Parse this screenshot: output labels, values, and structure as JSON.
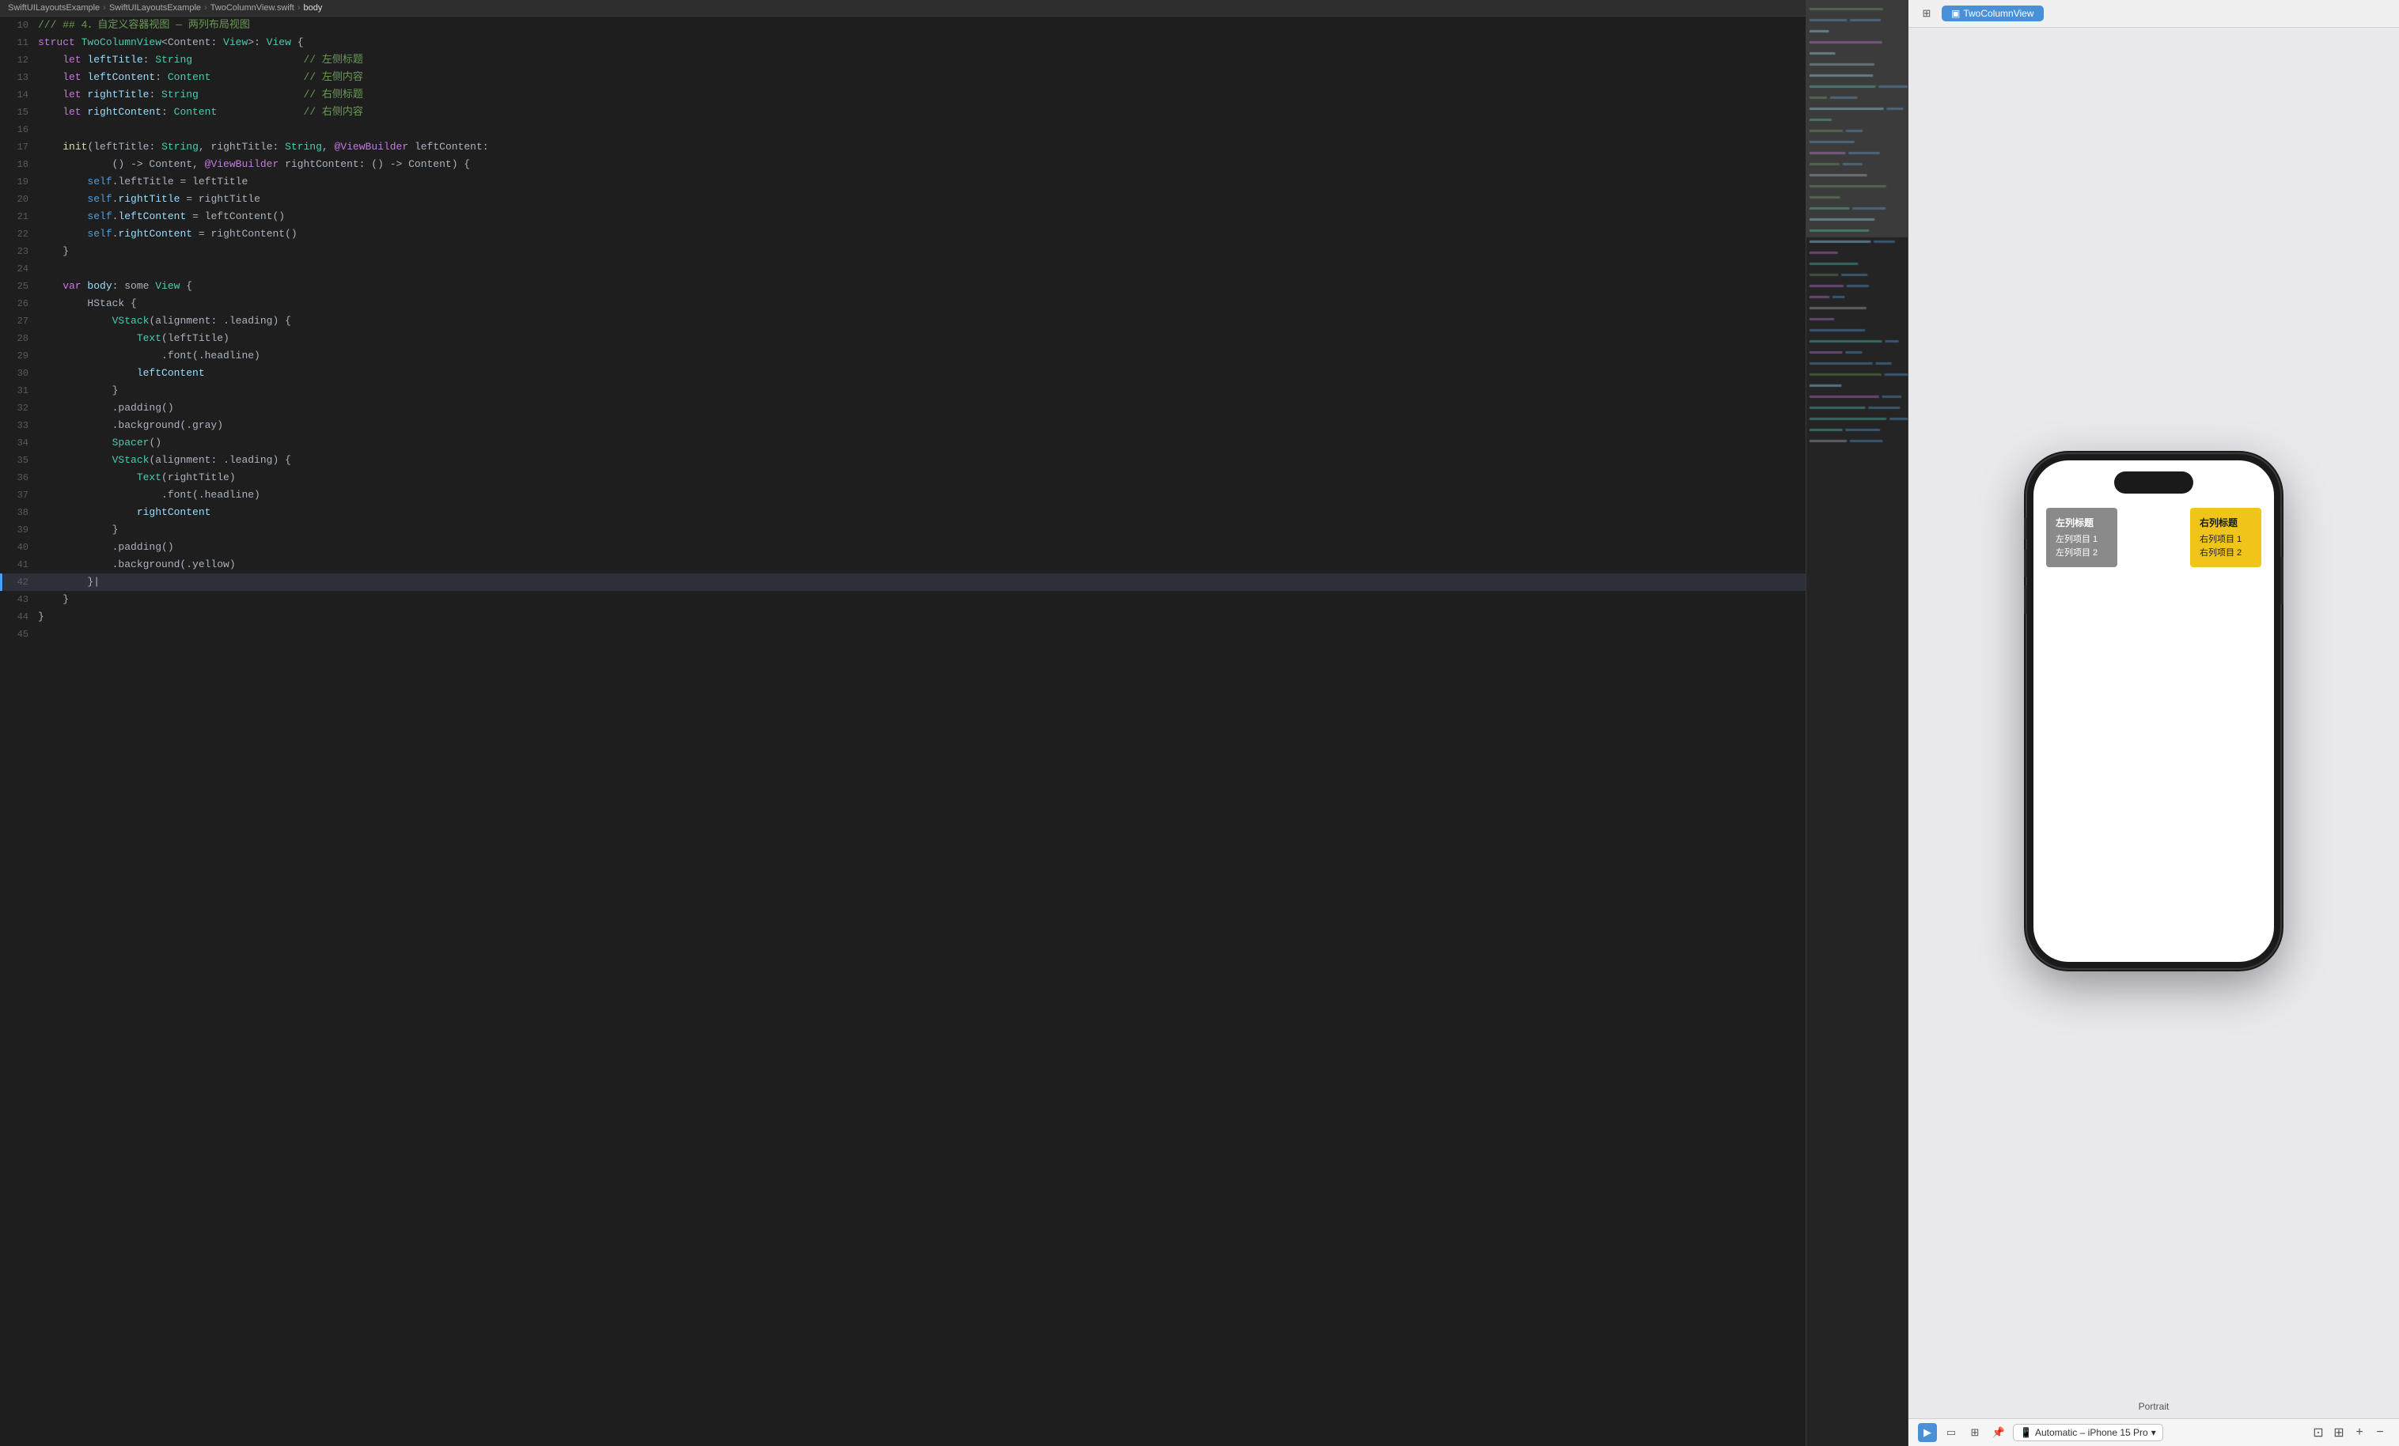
{
  "breadcrumb": {
    "items": [
      {
        "label": "SwiftUILayoutsExample",
        "active": false
      },
      {
        "label": "SwiftUILayoutsExample",
        "active": false
      },
      {
        "label": "TwoColumnView.swift",
        "active": false
      },
      {
        "label": "body",
        "active": true
      }
    ]
  },
  "editor": {
    "lines": [
      {
        "num": 10,
        "tokens": [
          {
            "text": "/// ## 4．自定义容器视图 — 两列布局视图",
            "cls": "kw-comment"
          }
        ]
      },
      {
        "num": 11,
        "tokens": [
          {
            "text": "struct ",
            "cls": "kw-pink"
          },
          {
            "text": "TwoColumnView",
            "cls": "kw-type"
          },
          {
            "text": "<Content: ",
            "cls": "kw-white"
          },
          {
            "text": "View",
            "cls": "kw-type"
          },
          {
            "text": ">: ",
            "cls": "kw-white"
          },
          {
            "text": "View",
            "cls": "kw-type"
          },
          {
            "text": " {",
            "cls": "kw-white"
          }
        ]
      },
      {
        "num": 12,
        "tokens": [
          {
            "text": "    let ",
            "cls": "kw-pink"
          },
          {
            "text": "leftTitle",
            "cls": "kw-var"
          },
          {
            "text": ": ",
            "cls": "kw-white"
          },
          {
            "text": "String",
            "cls": "kw-type"
          },
          {
            "text": "                  // 左侧标题",
            "cls": "kw-comment"
          }
        ]
      },
      {
        "num": 13,
        "tokens": [
          {
            "text": "    let ",
            "cls": "kw-pink"
          },
          {
            "text": "leftContent",
            "cls": "kw-var"
          },
          {
            "text": ": ",
            "cls": "kw-white"
          },
          {
            "text": "Content",
            "cls": "kw-type"
          },
          {
            "text": "               // 左侧内容",
            "cls": "kw-comment"
          }
        ]
      },
      {
        "num": 14,
        "tokens": [
          {
            "text": "    let ",
            "cls": "kw-pink"
          },
          {
            "text": "rightTitle",
            "cls": "kw-var"
          },
          {
            "text": ": ",
            "cls": "kw-white"
          },
          {
            "text": "String",
            "cls": "kw-type"
          },
          {
            "text": "                 // 右侧标题",
            "cls": "kw-comment"
          }
        ]
      },
      {
        "num": 15,
        "tokens": [
          {
            "text": "    let ",
            "cls": "kw-pink"
          },
          {
            "text": "rightContent",
            "cls": "kw-var"
          },
          {
            "text": ": ",
            "cls": "kw-white"
          },
          {
            "text": "Content",
            "cls": "kw-type"
          },
          {
            "text": "              // 右侧内容",
            "cls": "kw-comment"
          }
        ]
      },
      {
        "num": 16,
        "tokens": []
      },
      {
        "num": 17,
        "tokens": [
          {
            "text": "    ",
            "cls": ""
          },
          {
            "text": "init",
            "cls": "kw-func"
          },
          {
            "text": "(leftTitle: ",
            "cls": "kw-white"
          },
          {
            "text": "String",
            "cls": "kw-type"
          },
          {
            "text": ", rightTitle: ",
            "cls": "kw-white"
          },
          {
            "text": "String",
            "cls": "kw-type"
          },
          {
            "text": ", ",
            "cls": "kw-white"
          },
          {
            "text": "@ViewBuilder",
            "cls": "kw-pink"
          },
          {
            "text": " leftContent:",
            "cls": "kw-white"
          }
        ]
      },
      {
        "num": 18,
        "tokens": [
          {
            "text": "            () -> Content, ",
            "cls": "kw-white"
          },
          {
            "text": "@ViewBuilder",
            "cls": "kw-pink"
          },
          {
            "text": " rightContent: () -> Content) {",
            "cls": "kw-white"
          }
        ]
      },
      {
        "num": 19,
        "tokens": [
          {
            "text": "        ",
            "cls": ""
          },
          {
            "text": "self",
            "cls": "kw-keyword"
          },
          {
            "text": ".leftTitle = leftTitle",
            "cls": "kw-white"
          }
        ]
      },
      {
        "num": 20,
        "tokens": [
          {
            "text": "        ",
            "cls": ""
          },
          {
            "text": "self",
            "cls": "kw-keyword"
          },
          {
            "text": ".",
            "cls": "kw-white"
          },
          {
            "text": "rightTitle",
            "cls": "kw-var"
          },
          {
            "text": " = rightTitle",
            "cls": "kw-white"
          }
        ]
      },
      {
        "num": 21,
        "tokens": [
          {
            "text": "        ",
            "cls": ""
          },
          {
            "text": "self",
            "cls": "kw-keyword"
          },
          {
            "text": ".",
            "cls": "kw-white"
          },
          {
            "text": "leftContent",
            "cls": "kw-var"
          },
          {
            "text": " = leftContent()",
            "cls": "kw-white"
          }
        ]
      },
      {
        "num": 22,
        "tokens": [
          {
            "text": "        ",
            "cls": ""
          },
          {
            "text": "self",
            "cls": "kw-keyword"
          },
          {
            "text": ".",
            "cls": "kw-white"
          },
          {
            "text": "rightContent",
            "cls": "kw-var"
          },
          {
            "text": " = rightContent()",
            "cls": "kw-white"
          }
        ]
      },
      {
        "num": 23,
        "tokens": [
          {
            "text": "    }",
            "cls": "kw-white"
          }
        ]
      },
      {
        "num": 24,
        "tokens": []
      },
      {
        "num": 25,
        "tokens": [
          {
            "text": "    var ",
            "cls": "kw-pink"
          },
          {
            "text": "body",
            "cls": "kw-var"
          },
          {
            "text": ": some ",
            "cls": "kw-white"
          },
          {
            "text": "View",
            "cls": "kw-type"
          },
          {
            "text": " {",
            "cls": "kw-white"
          }
        ]
      },
      {
        "num": 26,
        "tokens": [
          {
            "text": "        HStack {",
            "cls": "kw-white"
          }
        ]
      },
      {
        "num": 27,
        "tokens": [
          {
            "text": "            ",
            "cls": ""
          },
          {
            "text": "VStack",
            "cls": "kw-type"
          },
          {
            "text": "(alignment: .leading) {",
            "cls": "kw-white"
          }
        ]
      },
      {
        "num": 28,
        "tokens": [
          {
            "text": "                ",
            "cls": ""
          },
          {
            "text": "Text",
            "cls": "kw-type"
          },
          {
            "text": "(leftTitle)",
            "cls": "kw-white"
          }
        ]
      },
      {
        "num": 29,
        "tokens": [
          {
            "text": "                    .font(.headline)",
            "cls": "kw-white"
          }
        ]
      },
      {
        "num": 30,
        "tokens": [
          {
            "text": "                ",
            "cls": ""
          },
          {
            "text": "leftContent",
            "cls": "kw-var"
          }
        ]
      },
      {
        "num": 31,
        "tokens": [
          {
            "text": "            }",
            "cls": "kw-white"
          }
        ]
      },
      {
        "num": 32,
        "tokens": [
          {
            "text": "            .padding()",
            "cls": "kw-white"
          }
        ]
      },
      {
        "num": 33,
        "tokens": [
          {
            "text": "            .background(.gray)",
            "cls": "kw-white"
          }
        ]
      },
      {
        "num": 34,
        "tokens": [
          {
            "text": "            ",
            "cls": ""
          },
          {
            "text": "Spacer",
            "cls": "kw-type"
          },
          {
            "text": "()",
            "cls": "kw-white"
          }
        ]
      },
      {
        "num": 35,
        "tokens": [
          {
            "text": "            ",
            "cls": ""
          },
          {
            "text": "VStack",
            "cls": "kw-type"
          },
          {
            "text": "(alignment: .leading) {",
            "cls": "kw-white"
          }
        ]
      },
      {
        "num": 36,
        "tokens": [
          {
            "text": "                ",
            "cls": ""
          },
          {
            "text": "Text",
            "cls": "kw-type"
          },
          {
            "text": "(rightTitle)",
            "cls": "kw-white"
          }
        ]
      },
      {
        "num": 37,
        "tokens": [
          {
            "text": "                    .font(.headline)",
            "cls": "kw-white"
          }
        ]
      },
      {
        "num": 38,
        "tokens": [
          {
            "text": "                ",
            "cls": ""
          },
          {
            "text": "rightContent",
            "cls": "kw-var"
          }
        ]
      },
      {
        "num": 39,
        "tokens": [
          {
            "text": "            }",
            "cls": "kw-white"
          }
        ]
      },
      {
        "num": 40,
        "tokens": [
          {
            "text": "            .padding()",
            "cls": "kw-white"
          }
        ]
      },
      {
        "num": 41,
        "tokens": [
          {
            "text": "            .background(.yellow)",
            "cls": "kw-white"
          }
        ]
      },
      {
        "num": 42,
        "tokens": [
          {
            "text": "        }|",
            "cls": "kw-white"
          }
        ],
        "active": true,
        "indicator": true
      },
      {
        "num": 43,
        "tokens": [
          {
            "text": "    }",
            "cls": "kw-white"
          }
        ]
      },
      {
        "num": 44,
        "tokens": [
          {
            "text": "}",
            "cls": "kw-white"
          }
        ]
      },
      {
        "num": 45,
        "tokens": []
      }
    ]
  },
  "preview": {
    "tab_label": "TwoColumnView",
    "portrait_label": "Portrait",
    "device_label": "Automatic – iPhone 15 Pro",
    "left_col": {
      "title": "左列标题",
      "items": [
        "左列项目 1",
        "左列项目 2"
      ]
    },
    "right_col": {
      "title": "右列标题",
      "items": [
        "右列项目 1",
        "右列项目 2"
      ]
    }
  },
  "toolbar": {
    "zoom_in": "+",
    "zoom_out": "−",
    "zoom_fit": "⊡",
    "zoom_actual": "⊞"
  }
}
